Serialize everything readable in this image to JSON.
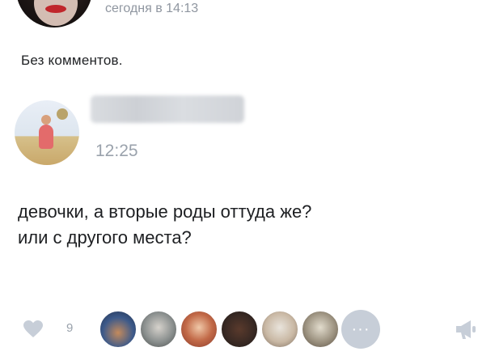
{
  "post": {
    "timestamp": "сегодня в 14:13",
    "text": "Без комментов."
  },
  "comment": {
    "author_name_hidden": true,
    "time": "12:25",
    "text_lines": [
      "девочки, а вторые роды оттуда же?",
      "или с другого места?"
    ]
  },
  "likes": {
    "count": "9",
    "more_label": "···",
    "liker_avatars": [
      "liker-avatar",
      "liker-avatar",
      "liker-avatar",
      "liker-avatar",
      "liker-avatar",
      "liker-avatar"
    ]
  },
  "icons": {
    "like": "heart-icon",
    "share": "share-megaphone-icon",
    "more": "more-dots-icon"
  },
  "colors": {
    "muted_text": "#9aa2ac",
    "icon_gray": "#c7ced8",
    "text": "#1d1f22"
  }
}
